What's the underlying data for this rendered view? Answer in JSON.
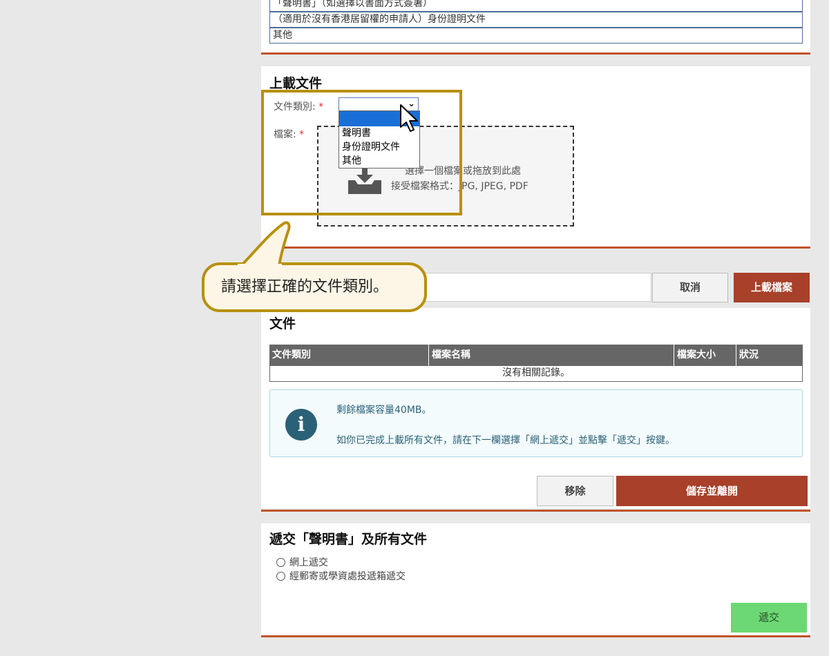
{
  "top_table": {
    "rows": [
      "「聲明書」（如選擇以書面方式簽署）",
      "（適用於沒有香港居留權的申請人）身份證明文件",
      "其他"
    ]
  },
  "upload": {
    "title": "上載文件",
    "category_label": "文件類別:",
    "file_label": "檔案:",
    "required_mark": "*",
    "select_value": "",
    "options": [
      "聲明書",
      "身份證明文件",
      "其他"
    ],
    "dropzone_line1": "選擇一個檔案或拖放到此處",
    "dropzone_line2": "接受檔案格式：JPG, JPEG, PDF",
    "icon": "upload-tray-icon"
  },
  "callout": {
    "text": "請選擇正確的文件類別。"
  },
  "action_bar": {
    "cancel_label": "取消",
    "upload_label": "上載檔案"
  },
  "files": {
    "title": "文件",
    "columns": [
      "文件類別",
      "檔案名稱",
      "檔案大小",
      "狀況"
    ],
    "empty_text": "沒有相關記錄。",
    "info_line1": "剩餘檔案容量40MB。",
    "info_line2": "如你已完成上載所有文件，請在下一欄選擇「網上遞交」並點擊「遞交」按鍵。",
    "info_icon": "info-icon",
    "remove_label": "移除",
    "save_exit_label": "儲存並離開"
  },
  "submit": {
    "title": "遞交「聲明書」及所有文件",
    "options": [
      "網上遞交",
      "經郵寄或學資處投遞箱遞交"
    ],
    "submit_label": "遞交"
  },
  "colors": {
    "accent_red": "#a8402a",
    "highlight_gold": "#b8900c",
    "submit_green": "#6cd873",
    "table_header": "#666666"
  }
}
